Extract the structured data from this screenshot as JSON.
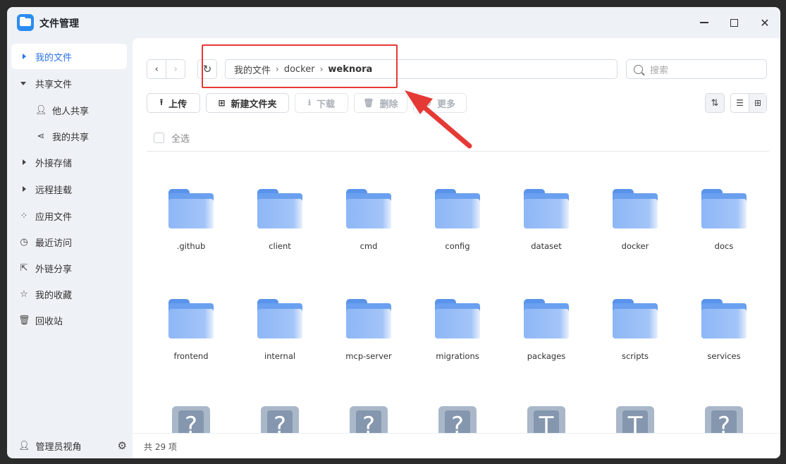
{
  "window": {
    "title": "文件管理"
  },
  "sidebar": {
    "items": [
      {
        "label": "我的文件",
        "active": true
      },
      {
        "label": "共享文件"
      },
      {
        "label": "他人共享"
      },
      {
        "label": "我的共享"
      },
      {
        "label": "外接存储"
      },
      {
        "label": "远程挂载"
      },
      {
        "label": "应用文件"
      },
      {
        "label": "最近访问"
      },
      {
        "label": "外链分享"
      },
      {
        "label": "我的收藏"
      },
      {
        "label": "回收站"
      }
    ],
    "footer_label": "管理员视角"
  },
  "path": {
    "root": "我的文件",
    "mid": "docker",
    "current": "weknora"
  },
  "search": {
    "placeholder": "搜索"
  },
  "toolbar": {
    "upload": "上传",
    "new_folder": "新建文件夹",
    "download": "下载",
    "delete": "删除",
    "more": "更多",
    "select_all": "全选"
  },
  "files": [
    {
      "name": ".github",
      "type": "folder"
    },
    {
      "name": "client",
      "type": "folder"
    },
    {
      "name": "cmd",
      "type": "folder"
    },
    {
      "name": "config",
      "type": "folder"
    },
    {
      "name": "dataset",
      "type": "folder"
    },
    {
      "name": "docker",
      "type": "folder"
    },
    {
      "name": "docs",
      "type": "folder"
    },
    {
      "name": "frontend",
      "type": "folder"
    },
    {
      "name": "internal",
      "type": "folder"
    },
    {
      "name": "mcp-server",
      "type": "folder"
    },
    {
      "name": "migrations",
      "type": "folder"
    },
    {
      "name": "packages",
      "type": "folder"
    },
    {
      "name": "scripts",
      "type": "folder"
    },
    {
      "name": "services",
      "type": "folder"
    },
    {
      "name": "",
      "type": "file",
      "glyph": "?"
    },
    {
      "name": "",
      "type": "file",
      "glyph": "?"
    },
    {
      "name": "",
      "type": "file",
      "glyph": "?"
    },
    {
      "name": "",
      "type": "file",
      "glyph": "?"
    },
    {
      "name": "",
      "type": "file",
      "glyph": "T"
    },
    {
      "name": "",
      "type": "file",
      "glyph": "T"
    },
    {
      "name": "",
      "type": "file",
      "glyph": "?"
    }
  ],
  "status": {
    "count_text": "共 29 项"
  },
  "colors": {
    "accent": "#2a72e8",
    "annotation": "#e53935",
    "folder": "#6aa0ef"
  }
}
